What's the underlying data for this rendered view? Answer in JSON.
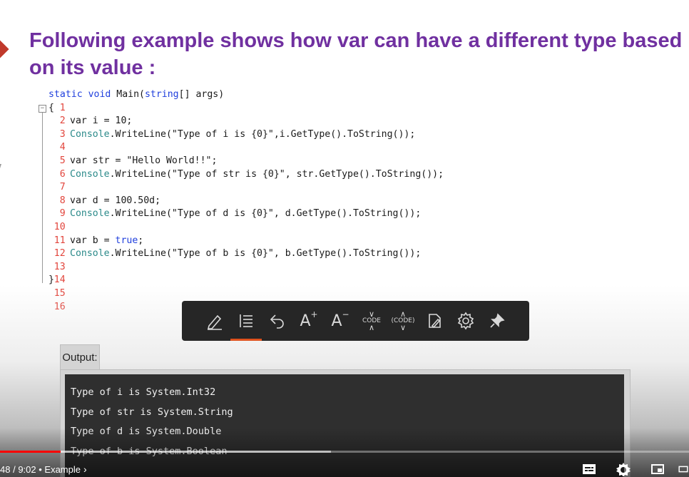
{
  "slide": {
    "title_line1": "Following example shows how var can have a different  type based",
    "title_line2": "on its value :",
    "title_color": "#7030a0"
  },
  "code": {
    "line_numbers": [
      "1",
      "2",
      "3",
      "4",
      "5",
      "6",
      "7",
      "8",
      "9",
      "10",
      "11",
      "12",
      "13",
      "14",
      "15",
      "16"
    ],
    "lines": [
      [
        {
          "t": "static void Main(",
          "c": "kw-mixed"
        },
        {
          "t": "",
          "c": ""
        }
      ],
      [],
      [],
      [],
      [],
      [],
      [],
      [],
      [],
      [],
      [],
      [],
      [],
      [],
      [],
      []
    ],
    "l1_a": "static void ",
    "l1_b": "Main(",
    "l1_c": "string",
    "l1_d": "[] args)",
    "l2": "{",
    "l3_a": "var",
    "l3_b": " i = 10;",
    "l4_a": "Console",
    "l4_b": ".WriteLine(\"Type of i is {0}\",i.GetType().ToString());",
    "l6_a": "var",
    "l6_b": " str = \"Hello World!!\";",
    "l7_a": "Console",
    "l7_b": ".WriteLine(\"Type of str is {0}\", str.GetType().ToString());",
    "l9_a": "var",
    "l9_b": " d = 100.50d;",
    "l10_a": "Console",
    "l10_b": ".WriteLine(\"Type of d is {0}\", d.GetType().ToString());",
    "l12_a": "var",
    "l12_b": " b = ",
    "l12_c": "true",
    "l12_d": ";",
    "l13_a": "Console",
    "l13_b": ".WriteLine(\"Type of b is {0}\", b.GetType().ToString());",
    "l15": "}",
    "keyword_color": "#1f3fdd",
    "class_color": "#2b8a8a",
    "line_number_color": "#e2453c"
  },
  "toolbar": {
    "code_label": "CODE",
    "code_paren_label": "(CODE)",
    "font_up_label": "A",
    "font_down_label": "A"
  },
  "output": {
    "tab_label": "Output:",
    "lines": [
      "Type of i is System.Int32",
      "Type of str is System.String",
      "Type of d is System.Double",
      "Type of b is System.Boolean"
    ]
  },
  "player": {
    "time_current": "48",
    "time_separator": " / ",
    "time_total": "9:02",
    "chapter_separator": " • ",
    "chapter": "Example",
    "progress_fraction": 0.0885,
    "buffer_fraction": 0.48,
    "progress_color": "#ff0000"
  }
}
